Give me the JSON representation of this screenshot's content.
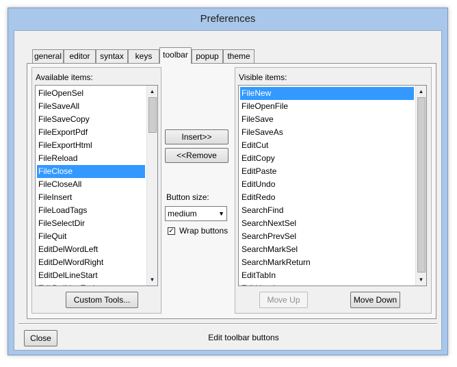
{
  "window": {
    "title": "Preferences"
  },
  "tabs": [
    {
      "label": "general"
    },
    {
      "label": "editor"
    },
    {
      "label": "syntax"
    },
    {
      "label": "keys"
    },
    {
      "label": "toolbar"
    },
    {
      "label": "popup"
    },
    {
      "label": "theme"
    }
  ],
  "active_tab": "toolbar",
  "available": {
    "label": "Available items:",
    "selected": "FileClose",
    "items": [
      "FileOpenSel",
      "FileSaveAll",
      "FileSaveCopy",
      "FileExportPdf",
      "FileExportHtml",
      "FileReload",
      "FileClose",
      "FileCloseAll",
      "FileInsert",
      "FileLoadTags",
      "FileSelectDir",
      "FileQuit",
      "EditDelWordLeft",
      "EditDelWordRight",
      "EditDelLineStart",
      "EditDelLineEnd"
    ],
    "custom_tools_label": "Custom Tools..."
  },
  "visible": {
    "label": "Visible items:",
    "selected": "FileNew",
    "items": [
      "FileNew",
      "FileOpenFile",
      "FileSave",
      "FileSaveAs",
      "EditCut",
      "EditCopy",
      "EditPaste",
      "EditUndo",
      "EditRedo",
      "SearchFind",
      "SearchNextSel",
      "SearchPrevSel",
      "SearchMarkSel",
      "SearchMarkReturn",
      "EditTabIn",
      "EditUntab"
    ],
    "move_up_label": "Move Up",
    "move_down_label": "Move Down"
  },
  "middle": {
    "insert_label": "Insert>>",
    "remove_label": "<<Remove",
    "button_size_label": "Button size:",
    "button_size_value": "medium",
    "wrap_label": "Wrap buttons",
    "wrap_checked": true
  },
  "footer": {
    "close_label": "Close",
    "status": "Edit toolbar buttons"
  },
  "icons": {
    "scroll_up": "▲",
    "scroll_down": "▼",
    "combo_arrow": "▼",
    "check": "✓"
  }
}
